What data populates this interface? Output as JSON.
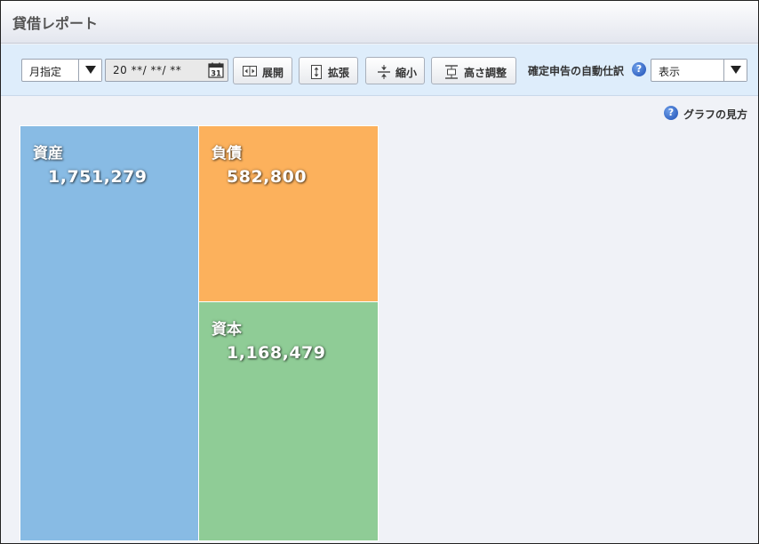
{
  "window": {
    "title": "貸借レポート"
  },
  "toolbar": {
    "period_select": "月指定",
    "date_value": "20 **/ **/ **",
    "calendar_day": "31",
    "expand_label": "展開",
    "enlarge_label": "拡張",
    "shrink_label": "縮小",
    "height_adjust_label": "高さ調整",
    "auto_journal_label": "確定申告の自動仕訳",
    "display_select": "表示"
  },
  "graph_help": {
    "label": "グラフの見方",
    "icon": "?"
  },
  "colors": {
    "assets": "#88bbe4",
    "liabilities": "#fcb15c",
    "equity": "#8fcc96",
    "help_icon": "#1e4fb5"
  },
  "chart_data": {
    "type": "treemap",
    "blocks": [
      {
        "name": "資産",
        "value": "1,751,279"
      },
      {
        "name": "負債",
        "value": "582,800"
      },
      {
        "name": "資本",
        "value": "1,168,479"
      }
    ]
  }
}
